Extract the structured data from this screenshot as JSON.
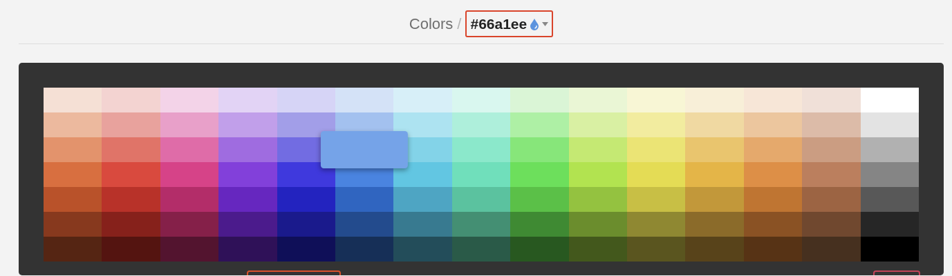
{
  "breadcrumb": {
    "root": "Colors",
    "separator": "/",
    "current": "#66a1ee"
  },
  "palette": [
    {
      "swatches": [
        {
          "color": "#f5e0d5",
          "selected": false
        },
        {
          "color": "#ecb99e",
          "selected": false
        },
        {
          "color": "#e3936c",
          "selected": false
        },
        {
          "color": "#d86f40",
          "selected": false
        },
        {
          "color": "#b9522a",
          "selected": false
        },
        {
          "color": "#87391e",
          "selected": false
        },
        {
          "color": "#552513",
          "selected": false
        }
      ]
    },
    {
      "swatches": [
        {
          "color": "#f3d3d1",
          "selected": false
        },
        {
          "color": "#e8a29d",
          "selected": false
        },
        {
          "color": "#e07468",
          "selected": false
        },
        {
          "color": "#d94a3e",
          "selected": false
        },
        {
          "color": "#b83229",
          "selected": false
        },
        {
          "color": "#86211b",
          "selected": false
        },
        {
          "color": "#541410",
          "selected": false
        }
      ]
    },
    {
      "swatches": [
        {
          "color": "#f3d3e8",
          "selected": false
        },
        {
          "color": "#e8a0c9",
          "selected": false
        },
        {
          "color": "#df6ca8",
          "selected": false
        },
        {
          "color": "#d64388",
          "selected": false
        },
        {
          "color": "#b32d69",
          "selected": false
        },
        {
          "color": "#852049",
          "selected": false
        },
        {
          "color": "#53142f",
          "selected": false
        }
      ]
    },
    {
      "swatches": [
        {
          "color": "#e2d3f5",
          "selected": false
        },
        {
          "color": "#c19fea",
          "selected": false
        },
        {
          "color": "#9f6ce0",
          "selected": false
        },
        {
          "color": "#8240da",
          "selected": false
        },
        {
          "color": "#6627bf",
          "selected": false
        },
        {
          "color": "#4b1b8c",
          "selected": false
        },
        {
          "color": "#2f1158",
          "selected": false
        }
      ]
    },
    {
      "swatches": [
        {
          "color": "#d6d4f6",
          "selected": false
        },
        {
          "color": "#a29ee8",
          "selected": false
        },
        {
          "color": "#726ce2",
          "selected": false
        },
        {
          "color": "#3f39dd",
          "selected": false
        },
        {
          "color": "#2323bf",
          "selected": false
        },
        {
          "color": "#1a1a8c",
          "selected": false
        },
        {
          "color": "#0f0f58",
          "selected": false
        }
      ]
    },
    {
      "swatches": [
        {
          "color": "#d4e2f7",
          "selected": false
        },
        {
          "color": "#a3c1ef",
          "selected": false
        },
        {
          "color": "#75a3e8",
          "selected": true
        },
        {
          "color": "#4a84e0",
          "selected": false
        },
        {
          "color": "#3065c0",
          "selected": false
        },
        {
          "color": "#234b8d",
          "selected": false
        },
        {
          "color": "#162f57",
          "selected": false
        }
      ]
    },
    {
      "swatches": [
        {
          "color": "#d7eff8",
          "selected": false
        },
        {
          "color": "#ade3f1",
          "selected": false
        },
        {
          "color": "#83d3e8",
          "selected": false
        },
        {
          "color": "#62c6e2",
          "selected": false
        },
        {
          "color": "#4ea5c3",
          "selected": false
        },
        {
          "color": "#387a90",
          "selected": false
        },
        {
          "color": "#234d5a",
          "selected": false
        }
      ]
    },
    {
      "swatches": [
        {
          "color": "#d9f7ef",
          "selected": false
        },
        {
          "color": "#aeefdb",
          "selected": false
        },
        {
          "color": "#8be8cb",
          "selected": false
        },
        {
          "color": "#70dfbb",
          "selected": false
        },
        {
          "color": "#5bc29f",
          "selected": false
        },
        {
          "color": "#448f73",
          "selected": false
        },
        {
          "color": "#2a5a48",
          "selected": false
        }
      ]
    },
    {
      "swatches": [
        {
          "color": "#daf5d6",
          "selected": false
        },
        {
          "color": "#aef0a5",
          "selected": false
        },
        {
          "color": "#87e67a",
          "selected": false
        },
        {
          "color": "#6ddf5c",
          "selected": false
        },
        {
          "color": "#5bc048",
          "selected": false
        },
        {
          "color": "#3f8a33",
          "selected": false
        },
        {
          "color": "#285820",
          "selected": false
        }
      ]
    },
    {
      "swatches": [
        {
          "color": "#eaf6d5",
          "selected": false
        },
        {
          "color": "#d9f0a3",
          "selected": false
        },
        {
          "color": "#c5e973",
          "selected": false
        },
        {
          "color": "#b2e350",
          "selected": false
        },
        {
          "color": "#94c240",
          "selected": false
        },
        {
          "color": "#6b8d2d",
          "selected": false
        },
        {
          "color": "#43581c",
          "selected": false
        }
      ]
    },
    {
      "swatches": [
        {
          "color": "#f8f6d5",
          "selected": false
        },
        {
          "color": "#f2ec9f",
          "selected": false
        },
        {
          "color": "#ebe475",
          "selected": false
        },
        {
          "color": "#e4dc55",
          "selected": false
        },
        {
          "color": "#c8bf45",
          "selected": false
        },
        {
          "color": "#8f8832",
          "selected": false
        },
        {
          "color": "#5a551f",
          "selected": false
        }
      ]
    },
    {
      "swatches": [
        {
          "color": "#f8efd8",
          "selected": false
        },
        {
          "color": "#f0d9a2",
          "selected": false
        },
        {
          "color": "#e9c56e",
          "selected": false
        },
        {
          "color": "#e4b548",
          "selected": false
        },
        {
          "color": "#c2983a",
          "selected": false
        },
        {
          "color": "#8b6b2a",
          "selected": false
        },
        {
          "color": "#58431a",
          "selected": false
        }
      ]
    },
    {
      "swatches": [
        {
          "color": "#f7e6d7",
          "selected": false
        },
        {
          "color": "#ecc69e",
          "selected": false
        },
        {
          "color": "#e5a96c",
          "selected": false
        },
        {
          "color": "#dd8f47",
          "selected": false
        },
        {
          "color": "#bf7532",
          "selected": false
        },
        {
          "color": "#8a5224",
          "selected": false
        },
        {
          "color": "#573315",
          "selected": false
        }
      ]
    },
    {
      "swatches": [
        {
          "color": "#f0e0d8",
          "selected": false
        },
        {
          "color": "#dcbba8",
          "selected": false
        },
        {
          "color": "#cb9d82",
          "selected": false
        },
        {
          "color": "#bb7f5e",
          "selected": false
        },
        {
          "color": "#9c6443",
          "selected": false
        },
        {
          "color": "#70482f",
          "selected": false
        },
        {
          "color": "#46301f",
          "selected": false
        }
      ]
    },
    {
      "swatches": [
        {
          "color": "#ffffff",
          "selected": false
        },
        {
          "color": "#e3e3e3",
          "selected": false
        },
        {
          "color": "#b1b1b1",
          "selected": false
        },
        {
          "color": "#858585",
          "selected": false
        },
        {
          "color": "#585858",
          "selected": false
        },
        {
          "color": "#262626",
          "selected": false
        },
        {
          "color": "#000000",
          "selected": false
        }
      ]
    }
  ]
}
